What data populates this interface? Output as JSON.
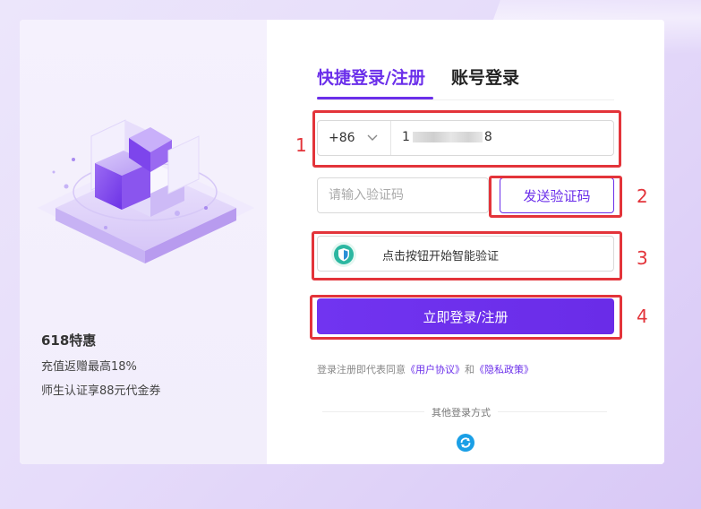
{
  "promo": {
    "title": "618特惠",
    "line1": "充值返赠最高18%",
    "line2": "师生认证享88元代金券"
  },
  "tabs": [
    {
      "label": "快捷登录/注册",
      "active": true
    },
    {
      "label": "账号登录",
      "active": false
    }
  ],
  "phone": {
    "country_code": "+86",
    "value_prefix": "1",
    "value_suffix": "8",
    "masked": true
  },
  "code": {
    "placeholder": "请输入验证码",
    "send_label": "发送验证码"
  },
  "verify": {
    "label": "点击按钮开始智能验证",
    "icon": "shield-icon"
  },
  "login_button": {
    "label": "立即登录/注册"
  },
  "agreement": {
    "prefix": "登录注册即代表同意",
    "user_agreement": "《用户协议》",
    "and": "和",
    "privacy_policy": "《隐私政策》"
  },
  "other_login": {
    "label": "其他登录方式",
    "icon": "refresh-circle-icon"
  },
  "annotations": [
    "1",
    "2",
    "3",
    "4"
  ],
  "colors": {
    "accent": "#6b2fea",
    "annotation": "#e3343a"
  }
}
